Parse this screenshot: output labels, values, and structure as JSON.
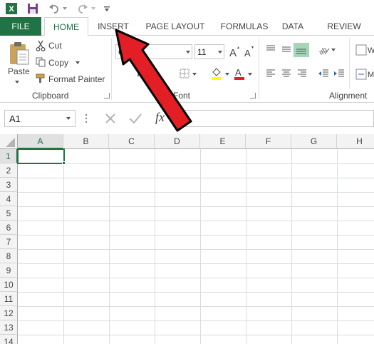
{
  "quick_access": {
    "icons": [
      "excel-icon",
      "save-icon",
      "undo-icon",
      "redo-icon",
      "customize-icon"
    ]
  },
  "tabs": [
    {
      "label": "FILE"
    },
    {
      "label": "HOME"
    },
    {
      "label": "INSERT"
    },
    {
      "label": "PAGE LAYOUT"
    },
    {
      "label": "FORMULAS"
    },
    {
      "label": "DATA"
    },
    {
      "label": "REVIEW"
    }
  ],
  "ribbon": {
    "clipboard": {
      "paste_label": "Paste",
      "cut_label": "Cut",
      "copy_label": "Copy",
      "format_painter_label": "Format Painter",
      "group_label": "Clipboard"
    },
    "font": {
      "font_name_value": "C",
      "font_size_value": "11",
      "group_label": "Font"
    },
    "alignment": {
      "group_label": "Alignment"
    }
  },
  "formula_bar": {
    "name_box_value": "A1",
    "fx_label": "fx"
  },
  "grid": {
    "columns": [
      "A",
      "B",
      "C",
      "D",
      "E",
      "F",
      "G",
      "H"
    ],
    "rows": [
      "1",
      "2",
      "3",
      "4",
      "5",
      "6",
      "7",
      "8",
      "9",
      "10",
      "11",
      "12",
      "13",
      "14"
    ],
    "selected_column": "A",
    "selected_row": "1"
  },
  "colors": {
    "accent": "#217346",
    "arrow": "#e31e24",
    "highlight": "#ffff00",
    "font_color": "#e31e24"
  }
}
